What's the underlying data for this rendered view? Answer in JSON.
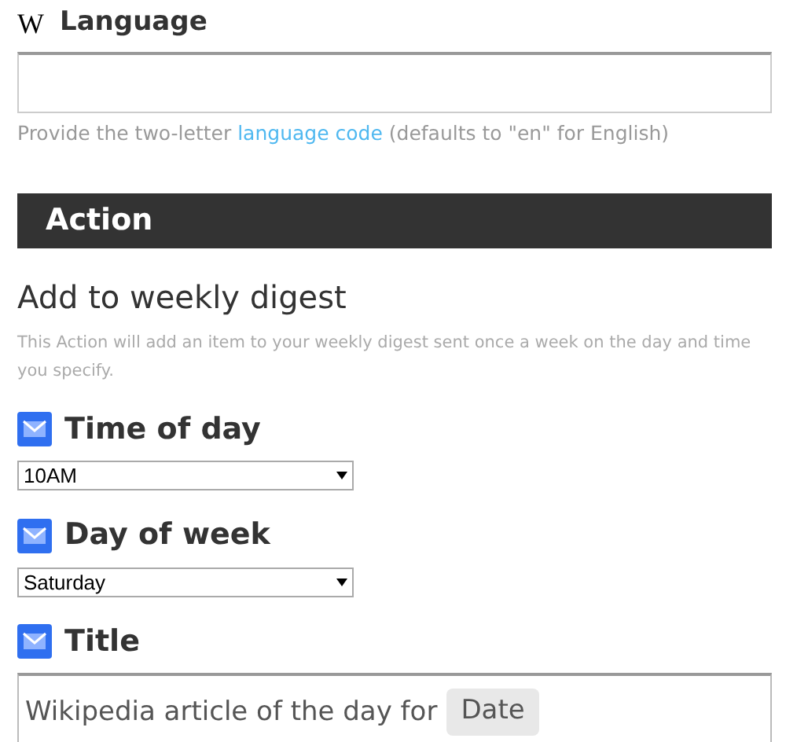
{
  "ingredient_field": {
    "logo": "W",
    "label": "Language",
    "hint_before": "Provide the two-letter ",
    "hint_link": "language code",
    "hint_after": " (defaults to \"en\" for English)"
  },
  "action": {
    "header": "Action",
    "title": "Add to weekly digest",
    "description": "This Action will add an item to your weekly digest sent once a week on the day and time you specify.",
    "fields": [
      {
        "kind": "select",
        "label": "Time of day",
        "value": "10AM"
      },
      {
        "kind": "select",
        "label": "Day of week",
        "value": "Saturday"
      },
      {
        "kind": "text",
        "label": "Title",
        "text": "Wikipedia article of the day for",
        "token": "Date"
      }
    ]
  }
}
